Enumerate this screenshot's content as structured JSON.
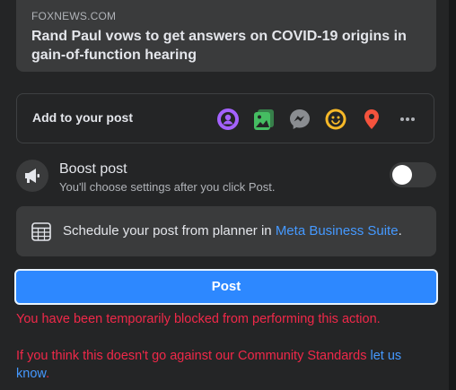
{
  "link_preview": {
    "domain": "FOXNEWS.COM",
    "title": "Rand Paul vows to get answers on COVID-19 origins in gain-of-function hearing"
  },
  "add_to_post": {
    "label": "Add to your post",
    "icons": [
      "tag-people-icon",
      "photo-video-icon",
      "messenger-icon",
      "feeling-emoji-icon",
      "check-in-location-icon",
      "more-options-icon"
    ]
  },
  "boost": {
    "title": "Boost post",
    "subtitle": "You'll choose settings after you click Post.",
    "enabled": false
  },
  "schedule": {
    "text": "Schedule your post from planner in ",
    "link": "Meta Business Suite",
    "suffix": "."
  },
  "post_button": {
    "label": "Post"
  },
  "errors": {
    "blocked": "You have been temporarily blocked from performing this action.",
    "appeal_text": "If you think this doesn't go against our Community Standards ",
    "appeal_link": "let us know",
    "appeal_suffix": "."
  },
  "colors": {
    "background": "#242526",
    "card": "#3a3b3c",
    "primary": "#2d88ff",
    "error": "#f02849",
    "link": "#4599ff"
  }
}
